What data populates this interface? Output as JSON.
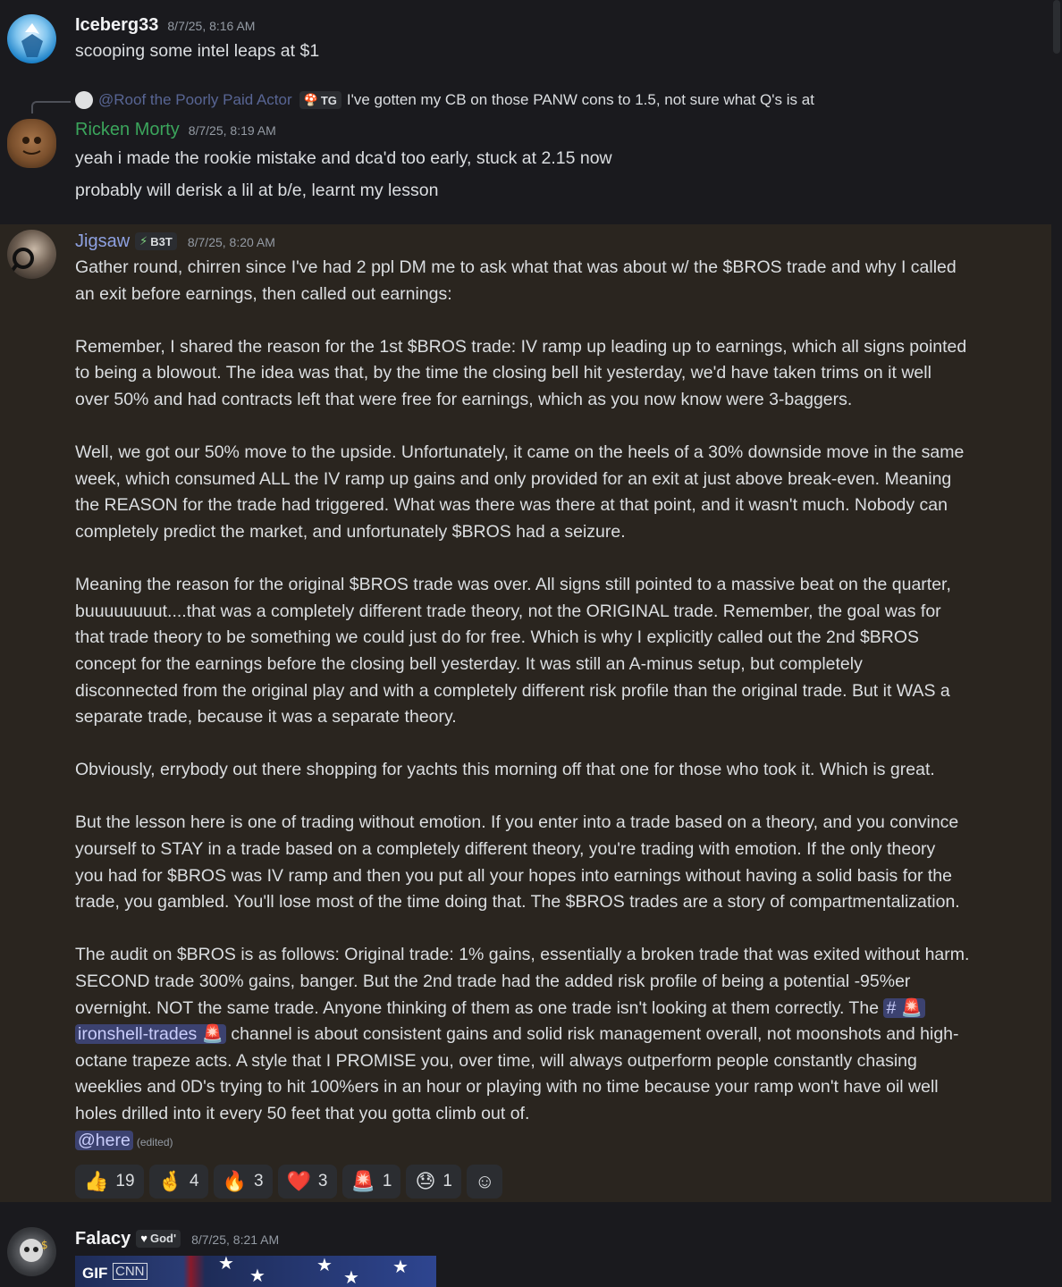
{
  "messages": {
    "iceberg": {
      "author": "Iceberg33",
      "timestamp": "8/7/25, 8:16 AM",
      "text": "scooping some intel leaps at $1"
    },
    "ricken": {
      "reply": {
        "author": "@Roof the Poorly Paid Actor",
        "tag": "TG",
        "text": "I've gotten my CB on those PANW cons to 1.5, not sure what Q's is at"
      },
      "author": "Ricken Morty",
      "timestamp": "8/7/25, 8:19 AM",
      "lines": [
        "yeah i made the rookie mistake and dca'd too early, stuck at 2.15 now",
        "probably will derisk a lil at b/e, learnt my lesson"
      ]
    },
    "jigsaw": {
      "author": "Jigsaw",
      "tag": "B3T",
      "timestamp": "8/7/25, 8:20 AM",
      "lines": [
        "Gather round, chirren since I've had 2 ppl DM me to ask what that was about w/ the $BROS trade and why I called",
        "an exit before earnings, then called out earnings:",
        "",
        "Remember, I shared the reason for the 1st $BROS trade:  IV ramp up leading up to earnings, which all signs pointed",
        "to being a blowout.  The idea was that, by the time the closing bell hit yesterday, we'd have taken trims on it well",
        "over 50% and had contracts left that were free for earnings, which as you now know were 3-baggers.",
        "",
        "Well, we got our 50% move to the upside.  Unfortunately, it came on the heels of a 30% downside move in the same",
        "week, which consumed ALL the IV ramp up gains and only provided for an exit at just above break-even.  Meaning",
        "the REASON for the trade had triggered.  What was there was there at that point, and it wasn't much.  Nobody can",
        "completely predict the market, and unfortunately $BROS had a seizure.",
        "",
        "Meaning the reason for the original $BROS trade was over.  All signs still pointed to a massive beat on the quarter,",
        "buuuuuuuut....that was a completely different trade theory, not the ORIGINAL trade.  Remember, the goal was for",
        "that trade theory to be something we could just do for free.  Which is why I explicitly called out the 2nd $BROS",
        "concept for the earnings before the closing bell yesterday.  It was still an A-minus setup, but completely",
        "disconnected from the original play and with a completely different risk profile than the original trade.  But it WAS a",
        "separate trade, because it was a separate theory.",
        "",
        "Obviously, errybody out there shopping for yachts this morning off that one for those who took it.  Which is great.",
        "",
        "But the lesson here is one of trading without emotion.  If you enter into a trade based on a theory, and you convince",
        "yourself to STAY in a trade based on a completely different theory, you're trading with emotion.  If the only theory",
        "you had for $BROS was IV ramp and then you put all your hopes into earnings without having a solid basis for the",
        "trade, you gambled.  You'll lose most of the time doing that.  The $BROS trades are a story of compartmentalization.",
        "",
        "The audit on $BROS is as follows:  Original trade: 1% gains, essentially a broken trade that was exited without harm.",
        "SECOND trade 300% gains, banger.  But the 2nd trade had the added risk profile of being a potential -95%er"
      ],
      "line_overnight": "overnight.  NOT the same trade.  Anyone thinking of them as one trade isn't looking at them correctly.  The",
      "channel_hash": "#",
      "channel_name": "ironshell-trades",
      "line_channel_rest": " channel is about consistent gains and solid risk management overall, not moonshots and high-",
      "tail_lines": [
        "octane trapeze acts.  A style that I PROMISE you, over time, will always outperform people constantly chasing",
        "weeklies and 0D's trying to hit 100%ers in an hour or playing with no time because your ramp won't have oil well",
        "holes drilled into it every 50 feet that you gotta climb out of."
      ],
      "mention": "@here",
      "edited": "(edited)",
      "reactions": [
        {
          "emoji": "👍",
          "count": "19"
        },
        {
          "emoji": "🤞",
          "count": "4"
        },
        {
          "emoji": "🔥",
          "count": "3"
        },
        {
          "emoji": "❤️",
          "count": "3"
        },
        {
          "emoji": "🚨",
          "count": "1"
        },
        {
          "emoji": "😓",
          "count": "1"
        }
      ],
      "add_reaction_icon": "☺"
    },
    "falacy": {
      "author": "Falacy",
      "tag": "God'",
      "timestamp": "8/7/25, 8:21 AM",
      "gif_label": "GIF",
      "gif_source": "CNN"
    }
  },
  "colors": {
    "background": "#1a1a1e",
    "highlight_bg": "#2a251f",
    "mention_bg": "#3c4270",
    "ricken_name": "#3ba55c"
  }
}
